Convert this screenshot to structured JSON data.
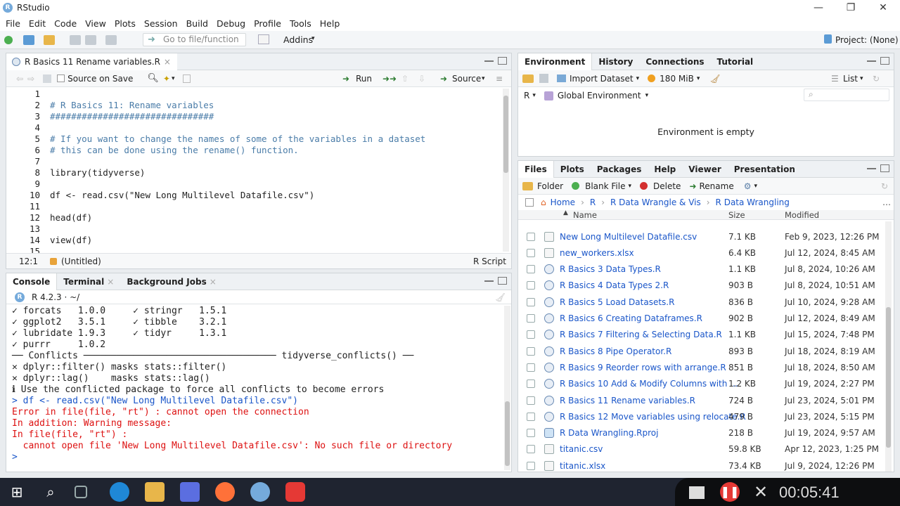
{
  "window": {
    "title": "RStudio"
  },
  "menu": [
    "File",
    "Edit",
    "Code",
    "View",
    "Plots",
    "Session",
    "Build",
    "Debug",
    "Profile",
    "Tools",
    "Help"
  ],
  "toolbar": {
    "goto_placeholder": "Go to file/function",
    "addins": "Addins",
    "project": "Project: (None)"
  },
  "source": {
    "tab": "R Basics 11 Rename variables.R",
    "source_on_save": "Source on Save",
    "run": "Run",
    "source_btn": "Source",
    "status_pos": "12:1",
    "status_scope": "(Untitled)",
    "status_type": "R Script",
    "lines": [
      {
        "n": "1",
        "text": "",
        "cls": ""
      },
      {
        "n": "2",
        "text": "# R Basics 11: Rename variables",
        "cls": "comment"
      },
      {
        "n": "3",
        "text": "###############################",
        "cls": "comment"
      },
      {
        "n": "4",
        "text": "",
        "cls": ""
      },
      {
        "n": "5",
        "text": "# If you want to change the names of some of the variables in a dataset",
        "cls": "comment"
      },
      {
        "n": "6",
        "text": "# this can be done using the rename() function.",
        "cls": "comment"
      },
      {
        "n": "7",
        "text": "",
        "cls": ""
      },
      {
        "n": "8",
        "text": "library(tidyverse)",
        "cls": ""
      },
      {
        "n": "9",
        "text": "",
        "cls": ""
      },
      {
        "n": "10",
        "text": "df <- read.csv(\"New Long Multilevel Datafile.csv\")",
        "cls": ""
      },
      {
        "n": "11",
        "text": "",
        "cls": ""
      },
      {
        "n": "12",
        "text": "head(df)",
        "cls": ""
      },
      {
        "n": "13",
        "text": "",
        "cls": ""
      },
      {
        "n": "14",
        "text": "view(df)",
        "cls": ""
      },
      {
        "n": "15",
        "text": "",
        "cls": ""
      }
    ]
  },
  "console": {
    "tabs": [
      "Console",
      "Terminal",
      "Background Jobs"
    ],
    "version": "R 4.2.3 · ~/",
    "lines": [
      {
        "text": "✓ forcats   1.0.0     ✓ stringr   1.5.1",
        "cls": ""
      },
      {
        "text": "✓ ggplot2   3.5.1     ✓ tibble    3.2.1",
        "cls": ""
      },
      {
        "text": "✓ lubridate 1.9.3     ✓ tidyr     1.3.1",
        "cls": ""
      },
      {
        "text": "✓ purrr     1.0.2",
        "cls": ""
      },
      {
        "text": "── Conflicts ─────────────────────────────────── tidyverse_conflicts() ──",
        "cls": ""
      },
      {
        "text": "✕ dplyr::filter() masks stats::filter()",
        "cls": ""
      },
      {
        "text": "✕ dplyr::lag()    masks stats::lag()",
        "cls": ""
      },
      {
        "text": "ℹ Use the conflicted package to force all conflicts to become errors",
        "cls": ""
      },
      {
        "text": "> df <- read.csv(\"New Long Multilevel Datafile.csv\")",
        "cls": "blue"
      },
      {
        "text": "Error in file(file, \"rt\") : cannot open the connection",
        "cls": "red"
      },
      {
        "text": "In addition: Warning message:",
        "cls": "red"
      },
      {
        "text": "In file(file, \"rt\") :",
        "cls": "red"
      },
      {
        "text": "  cannot open file 'New Long Multilevel Datafile.csv': No such file or directory",
        "cls": "red"
      },
      {
        "text": "> ",
        "cls": "blue"
      }
    ]
  },
  "environment": {
    "tabs": [
      "Environment",
      "History",
      "Connections",
      "Tutorial"
    ],
    "import_dataset": "Import Dataset",
    "memory": "180 MiB",
    "view": "List",
    "lang": "R",
    "scope": "Global Environment",
    "empty_msg": "Environment is empty"
  },
  "files": {
    "tabs": [
      "Files",
      "Plots",
      "Packages",
      "Help",
      "Viewer",
      "Presentation"
    ],
    "actions": {
      "folder": "Folder",
      "blank": "Blank File",
      "delete": "Delete",
      "rename": "Rename"
    },
    "breadcrumb": [
      "Home",
      "R",
      "R Data Wrangle & Vis",
      "R Data Wrangling"
    ],
    "columns": {
      "name": "Name",
      "size": "Size",
      "modified": "Modified"
    },
    "rows": [
      {
        "name": "New Long Multilevel Datafile.csv",
        "size": "7.1 KB",
        "modified": "Feb 9, 2023, 12:26 PM",
        "type": "doc"
      },
      {
        "name": "new_workers.xlsx",
        "size": "6.4 KB",
        "modified": "Jul 12, 2024, 8:45 AM",
        "type": "doc"
      },
      {
        "name": "R Basics 3 Data Types.R",
        "size": "1.1 KB",
        "modified": "Jul 8, 2024, 10:26 AM",
        "type": "r"
      },
      {
        "name": "R Basics 4 Data Types 2.R",
        "size": "903 B",
        "modified": "Jul 8, 2024, 10:51 AM",
        "type": "r"
      },
      {
        "name": "R Basics 5 Load Datasets.R",
        "size": "836 B",
        "modified": "Jul 10, 2024, 9:28 AM",
        "type": "r"
      },
      {
        "name": "R Basics 6 Creating Dataframes.R",
        "size": "902 B",
        "modified": "Jul 12, 2024, 8:49 AM",
        "type": "r"
      },
      {
        "name": "R Basics 7 Filtering & Selecting Data.R",
        "size": "1.1 KB",
        "modified": "Jul 15, 2024, 7:48 PM",
        "type": "r"
      },
      {
        "name": "R Basics 8 Pipe Operator.R",
        "size": "893 B",
        "modified": "Jul 18, 2024, 8:19 AM",
        "type": "r"
      },
      {
        "name": "R Basics 9 Reorder rows with arrange.R",
        "size": "851 B",
        "modified": "Jul 18, 2024, 8:50 AM",
        "type": "r"
      },
      {
        "name": "R Basics 10 Add & Modify Columns with ...",
        "size": "1.2 KB",
        "modified": "Jul 19, 2024, 2:27 PM",
        "type": "r"
      },
      {
        "name": "R Basics 11 Rename variables.R",
        "size": "724 B",
        "modified": "Jul 23, 2024, 5:01 PM",
        "type": "r"
      },
      {
        "name": "R Basics 12 Move variables using relocate.R",
        "size": "479 B",
        "modified": "Jul 23, 2024, 5:15 PM",
        "type": "r"
      },
      {
        "name": "R Data Wrangling.Rproj",
        "size": "218 B",
        "modified": "Jul 19, 2024, 9:57 AM",
        "type": "proj"
      },
      {
        "name": "titanic.csv",
        "size": "59.8 KB",
        "modified": "Apr 12, 2023, 1:25 PM",
        "type": "doc"
      },
      {
        "name": "titanic.xlsx",
        "size": "73.4 KB",
        "modified": "Jul 9, 2024, 12:26 PM",
        "type": "doc"
      }
    ]
  },
  "recording": {
    "time": "00:05:41"
  }
}
